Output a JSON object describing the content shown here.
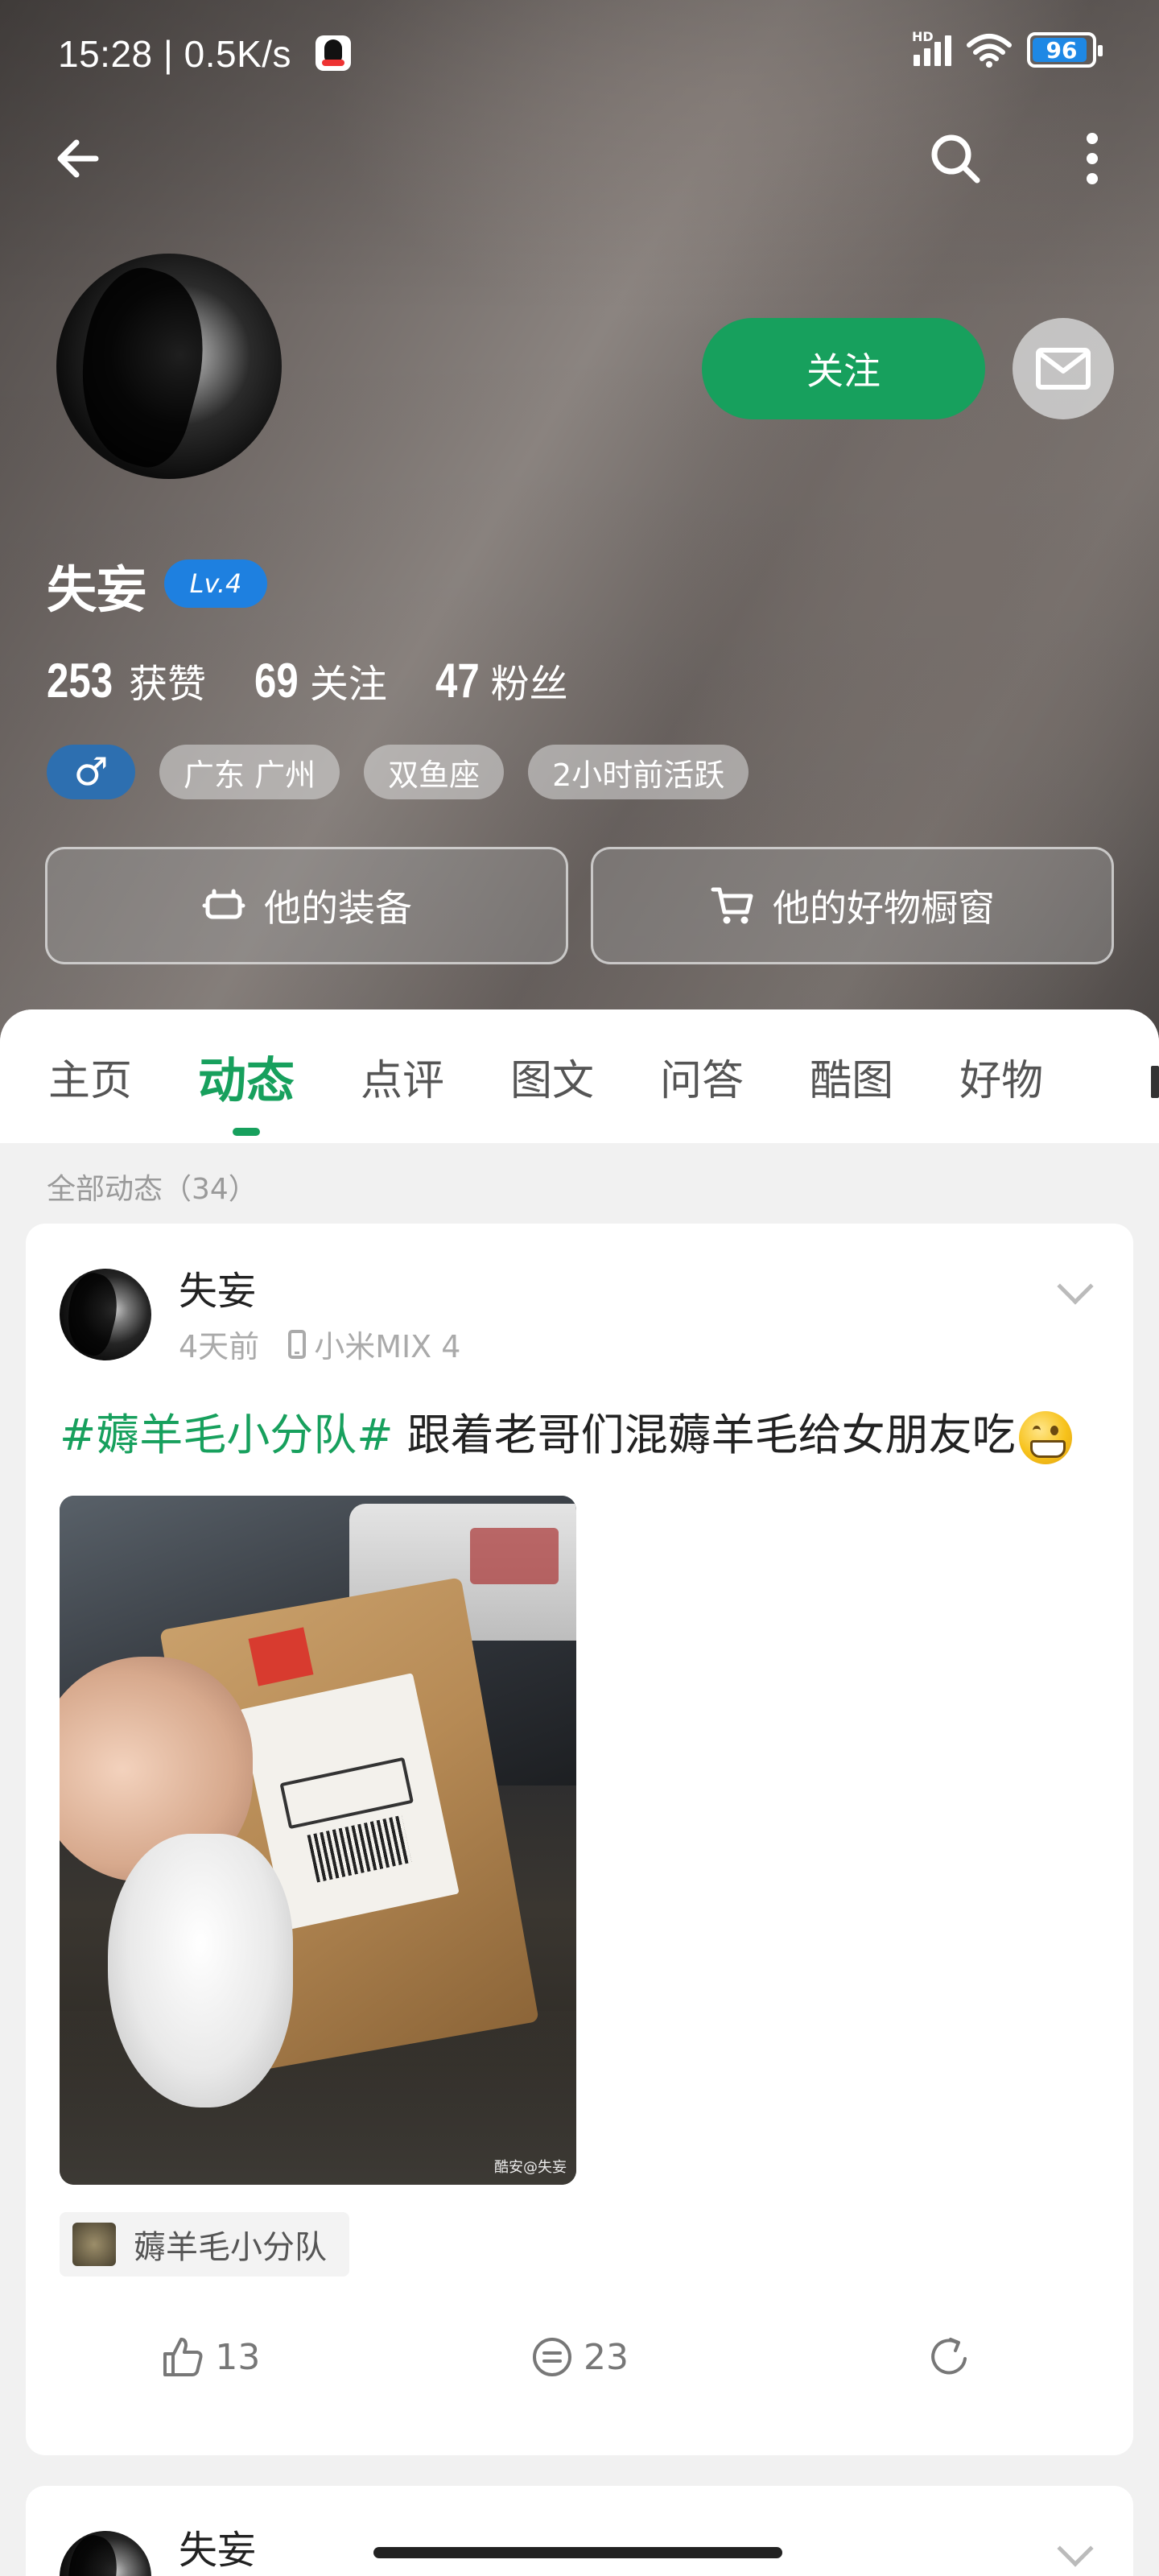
{
  "status_bar": {
    "time": "15:28 | 0.5K/s",
    "network": "HD",
    "battery": "96"
  },
  "header": {
    "back_icon": "back-arrow-icon",
    "search_icon": "search-icon",
    "more_icon": "more-vertical-icon"
  },
  "profile": {
    "name": "失妄",
    "level": "Lv.4",
    "follow_label": "关注",
    "stats": [
      {
        "num": "253",
        "label": "获赞"
      },
      {
        "num": "69",
        "label": "关注"
      },
      {
        "num": "47",
        "label": "粉丝"
      }
    ],
    "gender_symbol": "♂",
    "tags": [
      "广东 广州",
      "双鱼座",
      "2小时前活跃"
    ],
    "equipment_label": "他的装备",
    "shop_label": "他的好物橱窗"
  },
  "tabs": {
    "items": [
      "主页",
      "动态",
      "点评",
      "图文",
      "问答",
      "酷图",
      "好物"
    ],
    "active": "动态"
  },
  "feed": {
    "section_label": "全部动态（34）",
    "posts": [
      {
        "author": "失妄",
        "time": "4天前",
        "device": "小米MIX 4",
        "hashtag": "#薅羊毛小分队#",
        "text": " 跟着老哥们混薅羊毛给女朋友吃",
        "image_watermark": "酷安@失妄",
        "topic": "薅羊毛小分队",
        "likes": "13",
        "comments": "23"
      },
      {
        "author": "失妄"
      }
    ]
  },
  "colors": {
    "accent": "#17a05d",
    "level_badge": "#1e80e0",
    "gender_badge": "#2d6fb0"
  }
}
